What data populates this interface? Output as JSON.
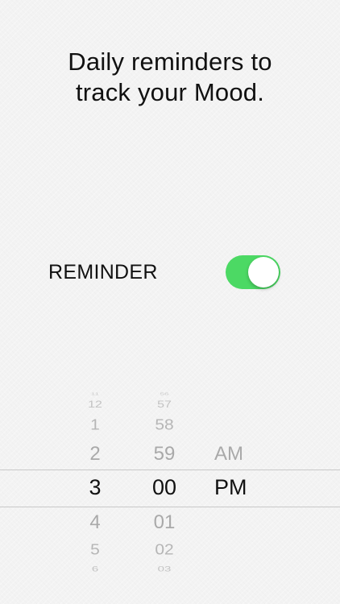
{
  "header": {
    "line1": "Daily reminders to",
    "line2": "track your Mood."
  },
  "reminder": {
    "label": "REMINDER",
    "enabled": true,
    "toggle_color": "#4cd964"
  },
  "time_picker": {
    "hours": [
      "11",
      "12",
      "1",
      "2",
      "3",
      "4",
      "5",
      "6"
    ],
    "minutes": [
      "56",
      "57",
      "58",
      "59",
      "00",
      "01",
      "02",
      "03"
    ],
    "periods": [
      "AM",
      "PM"
    ],
    "selected": {
      "hour": "3",
      "minute": "00",
      "period": "PM"
    }
  }
}
